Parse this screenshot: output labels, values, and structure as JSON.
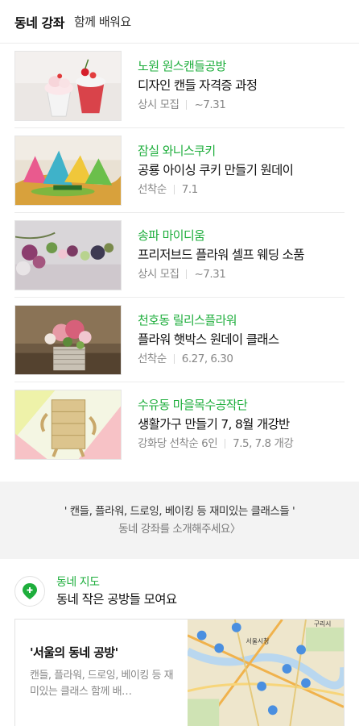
{
  "header": {
    "title": "동네 강좌",
    "subtitle": "함께 배워요"
  },
  "classes": [
    {
      "location": "노원 원스캔들공방",
      "name": "디자인 캔들 자격증 과정",
      "meta": [
        "상시 모집",
        "~7.31"
      ]
    },
    {
      "location": "잠실 와니스쿠키",
      "name": "공룡 아이싱 쿠키 만들기 원데이",
      "meta": [
        "선착순",
        "7.1"
      ]
    },
    {
      "location": "송파 마이디움",
      "name": "프리저브드 플라워 셀프 웨딩 소품",
      "meta": [
        "상시 모집",
        "~7.31"
      ]
    },
    {
      "location": "천호동 릴리스플라워",
      "name": "플라워 햇박스 원데이 클래스",
      "meta": [
        "선착순",
        "6.27, 6.30"
      ]
    },
    {
      "location": "수유동 마을목수공작단",
      "name": "생활가구 만들기 7, 8월 개강반",
      "meta": [
        "강화당 선착순 6인",
        "7.5, 7.8 개강"
      ]
    }
  ],
  "promo": {
    "line1": "' 캔들, 플라워, 드로잉, 베이킹 등 재미있는 클래스들 '",
    "line2": "동네 강좌를 소개해주세요〉"
  },
  "map": {
    "label": "동네 지도",
    "subtitle": "동네 작은 공방들 모여요",
    "card_title": "'서울의 동네 공방'",
    "card_desc": "캔들, 플라워, 드로잉, 베이킹 등 재미있는 클래스 함께 배…",
    "map_labels": [
      "서울시청",
      "구리시"
    ]
  },
  "colors": {
    "accent": "#1eae3c",
    "pin": "#4a8fe0"
  },
  "icons": {
    "map_badge": "map-pin-icon"
  }
}
